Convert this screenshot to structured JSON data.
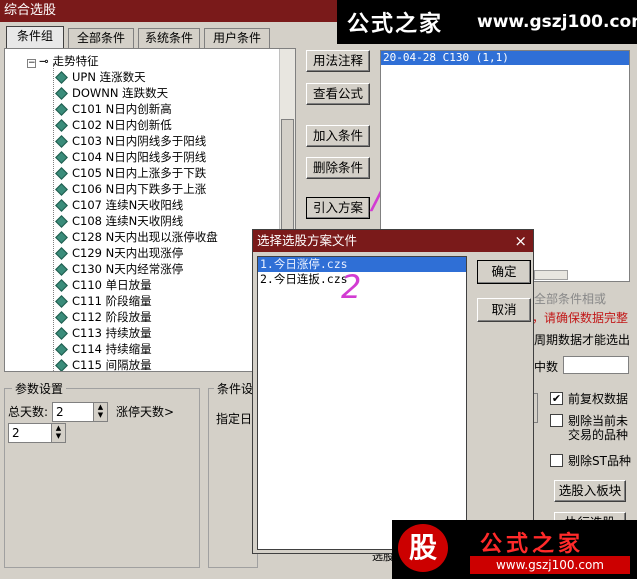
{
  "window": {
    "title": "综合选股"
  },
  "watermark": {
    "brand": "公式之家",
    "url": "www.gszj100.com"
  },
  "tabs": [
    "条件组",
    "全部条件",
    "系统条件",
    "用户条件"
  ],
  "tree": {
    "root": "走势特征",
    "items": [
      "UPN 连涨数天",
      "DOWNN 连跌数天",
      "C101 N日内创新高",
      "C102 N日内创新低",
      "C103 N日内阴线多于阳线",
      "C104 N日内阳线多于阴线",
      "C105 N日内上涨多于下跌",
      "C106 N日内下跌多于上涨",
      "C107 连续N天收阳线",
      "C108 连续N天收阴线",
      "C128 N天内出现以涨停收盘",
      "C129 N天内出现涨停",
      "C130 N天内经常涨停",
      "C110 单日放量",
      "C111 阶段缩量",
      "C112 阶段放量",
      "C113 持续放量",
      "C114 持续缩量",
      "C115 间隔放量"
    ]
  },
  "buttons": {
    "usage": "用法注释",
    "view_formula": "查看公式",
    "add_condition": "加入条件",
    "delete_condition": "删除条件",
    "import_plan": "引入方案",
    "select_to_block": "选股入板块",
    "execute": "执行选股"
  },
  "condition_list": {
    "selected": "20-04-28 C130 (1,1)"
  },
  "params": {
    "group_label": "参数设置",
    "total_days_label": "总天数:",
    "total_days_value": "2",
    "limit_days_label": "涨停天数>",
    "limit_days_value": "2"
  },
  "condition_group_label": "条件设",
  "specify_label": "指定日",
  "right_side": {
    "hint1": "全部条件相或",
    "hint2": "，请确保数据完整",
    "hint3": "周期数据才能选出",
    "in_count": "中数",
    "chk_qfq": "前复权数据",
    "chk_remove_untraded_1": "剔除当前未",
    "chk_remove_untraded_2": "交易的品种",
    "chk_remove_st": "剔除ST品种",
    "bottom_partial": "选股"
  },
  "dialog": {
    "title": "选择选股方案文件",
    "files": [
      "1.今日涨停.czs",
      "2.今日连扳.czs"
    ],
    "ok": "确定",
    "cancel": "取消",
    "close_icon": "×"
  },
  "annotations": {
    "mark1": "/",
    "mark2": "2"
  },
  "logo": {
    "char": "股",
    "brand": "公式之家",
    "url": "www.gszj100.com"
  },
  "colors": {
    "title_bar": "#7a1a1a",
    "selection": "#2f6fd6",
    "annotation": "#d23cd2"
  }
}
